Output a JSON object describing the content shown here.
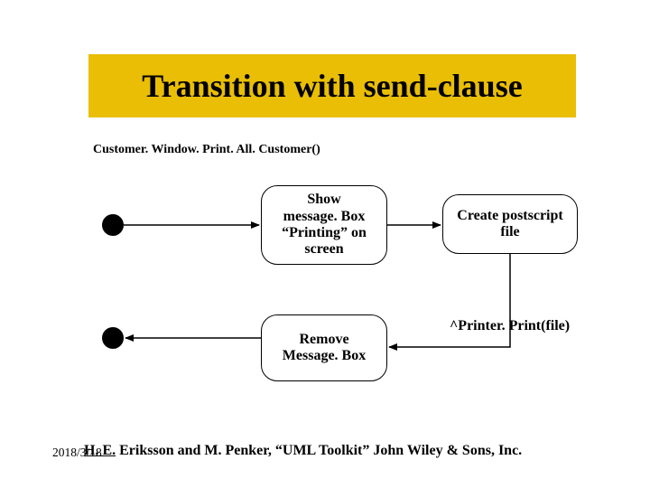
{
  "title": "Transition with send-clause",
  "event_label": "Customer. Window. Print. All. Customer()",
  "states": {
    "show_msg": "Show\nmessage. Box\n“Printing” on\nscreen",
    "create_ps": "Create postscript\nfile",
    "remove_msg": "Remove\nMessage. Box"
  },
  "send_action": "^Printer. Print(file)",
  "footer": {
    "prefix": "H. E.",
    "rest": " Eriksson and M. Penker, “UML Toolkit” John Wiley & Sons, Inc."
  },
  "date": "2018/3/18"
}
